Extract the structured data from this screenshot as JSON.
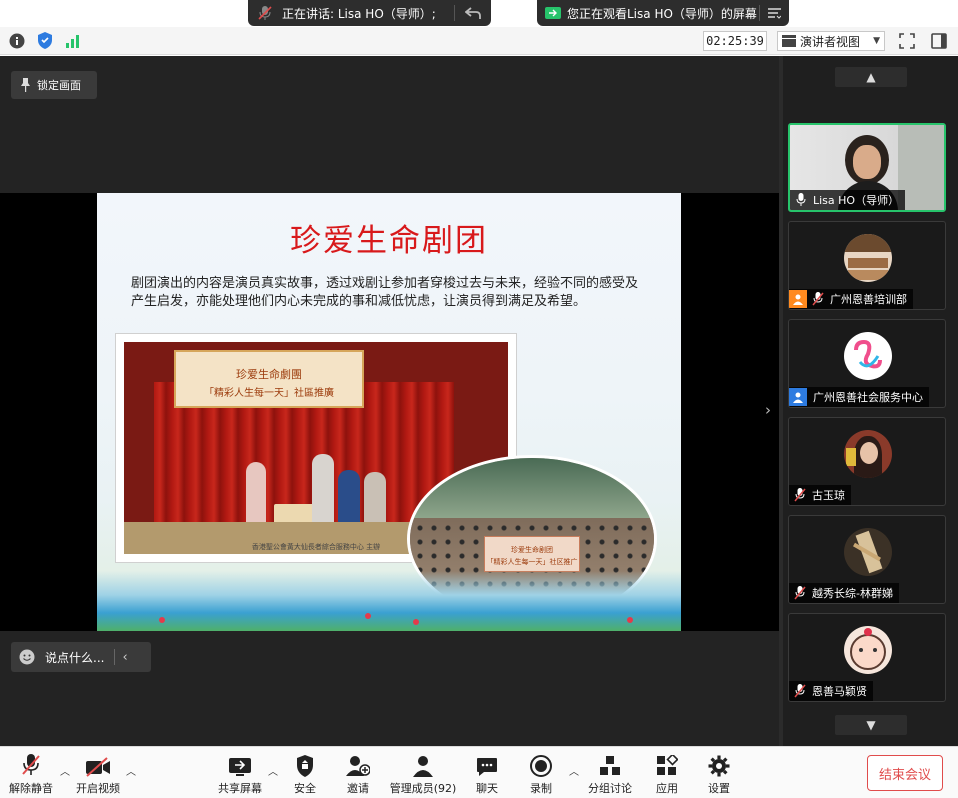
{
  "speaker_pill": {
    "text": "正在讲话: Lisa HO（导师）;"
  },
  "viewing_pill": {
    "text": "您正在观看Lisa HO（导师）的屏幕"
  },
  "status_bar": {
    "clock": "02:25:39",
    "view_mode": "演讲者视图"
  },
  "stage": {
    "lock_label": "锁定画面",
    "chat_placeholder": "说点什么..."
  },
  "slide": {
    "title": "珍爱生命剧团",
    "body": "剧团演出的内容是演员真实故事，透过戏剧让参加者穿梭过去与未来，经验不同的感受及产生启发，亦能处理他们内心未完成的事和减低忧虑，让演员得到满足及希望。",
    "banner1_lines": [
      "珍爱生命劇團",
      "「精彩人生每一天」社區推廣"
    ],
    "photo1_caption": "香港聖公會黃大仙長者綜合服務中心 主辦",
    "banner2_lines": [
      "珍爱生命剧团",
      "「精彩人生每一天」社区推广"
    ]
  },
  "participants": [
    {
      "name": "Lisa HO（导师）",
      "active": true
    },
    {
      "name": "广州恩善培训部",
      "active": false
    },
    {
      "name": "广州恩善社会服务中心",
      "active": false
    },
    {
      "name": "古玉琼",
      "active": false
    },
    {
      "name": "越秀长综-林群娣",
      "active": false
    },
    {
      "name": "恩善马颖贤",
      "active": false
    }
  ],
  "toolbar": {
    "unmute": "解除静音",
    "start_video": "开启视频",
    "share_screen": "共享屏幕",
    "security": "安全",
    "invite": "邀请",
    "participants": "管理成员(92)",
    "chat": "聊天",
    "record": "录制",
    "breakout": "分组讨论",
    "apps": "应用",
    "settings": "设置",
    "end_meeting": "结束会议"
  },
  "colors": {
    "accent_green": "#27c46b",
    "end_red": "#e04c4c",
    "title_red": "#d8191b"
  }
}
